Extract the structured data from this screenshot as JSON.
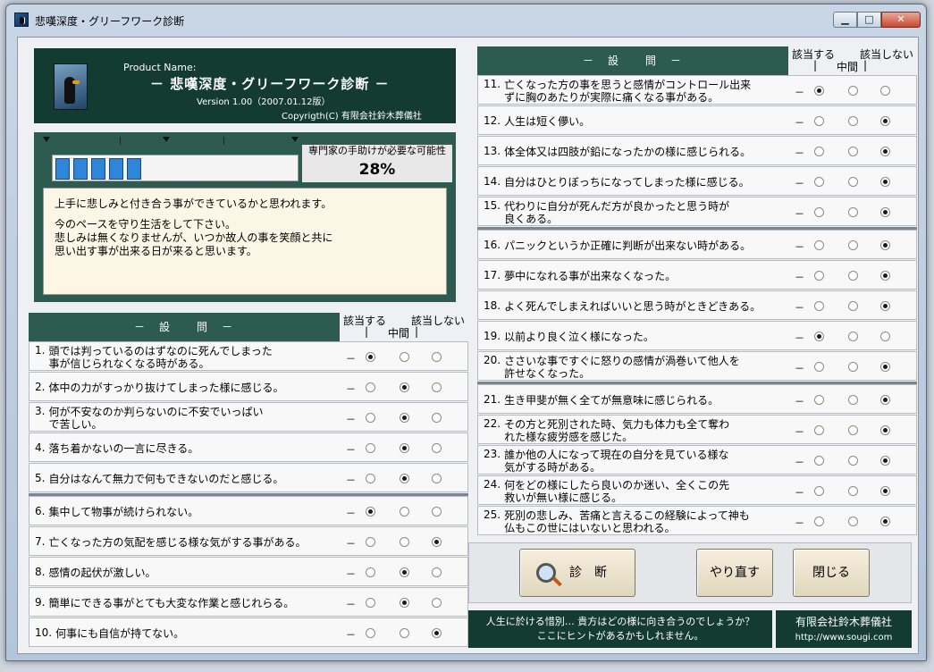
{
  "window": {
    "title": "悲嘆深度・グリーフワーク診断",
    "minimize": "▁",
    "maximize": "□",
    "close": "✕"
  },
  "brand": {
    "product_name_label": "Product Name:",
    "product_title": "－ 悲嘆深度・グリーフワーク診断 －",
    "version": "Version 1.00（2007.01.12版）",
    "copyright": "Copyrigth(C) 有限会社鈴木葬儀社"
  },
  "result": {
    "professional_label": "専門家の手助けが必要な可能性",
    "percent_text": "28%",
    "percent_value": 0.28,
    "filled_segments": 5,
    "message_lines": [
      "上手に悲しみと付き合う事ができているかと思われます。",
      "今のペースを守り生活をして下さい。",
      "悲しみは無くなりませんが、いつか故人の事を笑顔と共に",
      "思い出す事が出来る日が来ると思います。"
    ]
  },
  "header": {
    "question_title": "－　設　　問　－",
    "col_yes": "該当する",
    "col_mid": "中間",
    "col_no": "該当しない",
    "sep": "|"
  },
  "questions": [
    {
      "n": "1.",
      "text": [
        "頭では判っているのはずなのに死んでしまった",
        "事が信じられなくなる時がある。"
      ],
      "ans": 0
    },
    {
      "n": "2.",
      "text": [
        "体中の力がすっかり抜けてしまった様に感じる。"
      ],
      "ans": 1
    },
    {
      "n": "3.",
      "text": [
        "何が不安なのか判らないのに不安でいっぱい",
        "で苦しい。"
      ],
      "ans": 1
    },
    {
      "n": "4.",
      "text": [
        "落ち着かないの一言に尽きる。"
      ],
      "ans": 1
    },
    {
      "n": "5.",
      "text": [
        "自分はなんて無力で何もできないのだと感じる。"
      ],
      "ans": 1
    },
    {
      "n": "6.",
      "text": [
        "集中して物事が続けられない。"
      ],
      "ans": 0
    },
    {
      "n": "7.",
      "text": [
        "亡くなった方の気配を感じる様な気がする事がある。"
      ],
      "ans": 2
    },
    {
      "n": "8.",
      "text": [
        "感情の起伏が激しい。"
      ],
      "ans": 1
    },
    {
      "n": "9.",
      "text": [
        "簡単にできる事がとても大変な作業と感じれらる。"
      ],
      "ans": 1
    },
    {
      "n": "10.",
      "text": [
        "何事にも自信が持てない。"
      ],
      "ans": 2
    },
    {
      "n": "11.",
      "text": [
        "亡くなった方の事を思うと感情がコントロール出来",
        "ずに胸のあたりが実際に痛くなる事がある。"
      ],
      "ans": 0
    },
    {
      "n": "12.",
      "text": [
        "人生は短く儚い。"
      ],
      "ans": 2
    },
    {
      "n": "13.",
      "text": [
        "体全体又は四肢が鉛になったかの様に感じられる。"
      ],
      "ans": 2
    },
    {
      "n": "14.",
      "text": [
        "自分はひとりぼっちになってしまった様に感じる。"
      ],
      "ans": 2
    },
    {
      "n": "15.",
      "text": [
        "代わりに自分が死んだ方が良かったと思う時が",
        "良くある。"
      ],
      "ans": 2
    },
    {
      "n": "16.",
      "text": [
        "パニックというか正確に判断が出来ない時がある。"
      ],
      "ans": 2
    },
    {
      "n": "17.",
      "text": [
        "夢中になれる事が出来なくなった。"
      ],
      "ans": 2
    },
    {
      "n": "18.",
      "text": [
        "よく死んでしまえればいいと思う時がときどきある。"
      ],
      "ans": 2
    },
    {
      "n": "19.",
      "text": [
        "以前より良く泣く様になった。"
      ],
      "ans": 0
    },
    {
      "n": "20.",
      "text": [
        "ささいな事ですぐに怒りの感情が渦巻いて他人を",
        "許せなくなった。"
      ],
      "ans": 2
    },
    {
      "n": "21.",
      "text": [
        "生き甲斐が無く全てが無意味に感じられる。"
      ],
      "ans": 2
    },
    {
      "n": "22.",
      "text": [
        "その方と死別された時、気力も体力も全て奪わ",
        "れた様な疲労感を感じた。"
      ],
      "ans": 2
    },
    {
      "n": "23.",
      "text": [
        "誰か他の人になって現在の自分を見ている様な",
        "気がする時がある。"
      ],
      "ans": 2
    },
    {
      "n": "24.",
      "text": [
        "何をどの様にしたら良いのか迷い、全くこの先",
        "救いが無い様に感じる。"
      ],
      "ans": 2
    },
    {
      "n": "25.",
      "text": [
        "死別の悲しみ、苦痛と言えるこの経験によって神も",
        "仏もこの世にはいないと思われる。"
      ],
      "ans": 2
    }
  ],
  "dash": "－",
  "buttons": {
    "diagnose": "診　断",
    "redo": "やり直す",
    "close": "閉じる"
  },
  "hint": {
    "line1": "人生に於ける惜別…  貴方はどの様に向き合うのでしょうか？",
    "line2": "ここにヒントがあるかもしれません。"
  },
  "corp": {
    "name": "有限会社鈴木葬儀社",
    "url": "http://www.sougi.com"
  }
}
